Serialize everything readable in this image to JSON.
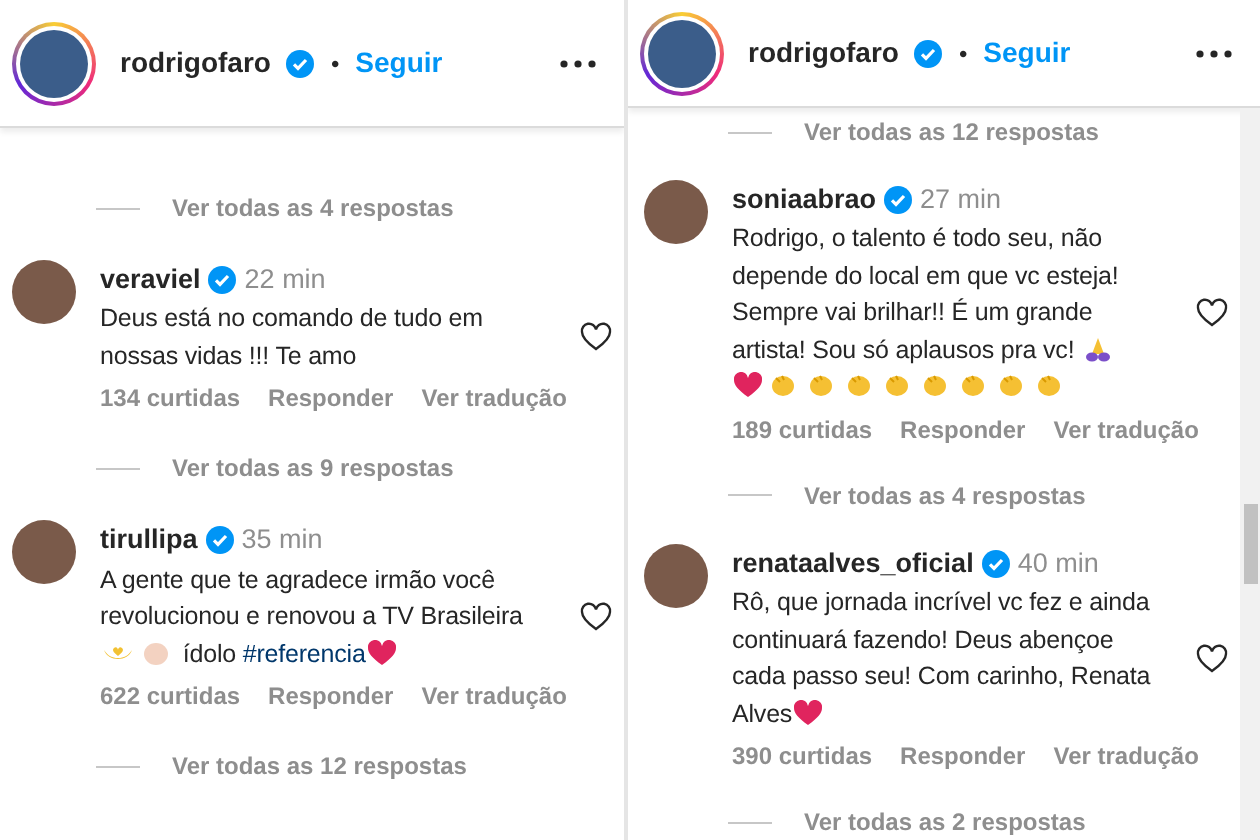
{
  "panels": [
    {
      "header": {
        "username": "rodrigofaro",
        "verified": true,
        "separator": "•",
        "follow": "Seguir"
      },
      "scrollbar": false,
      "items": [
        {
          "kind": "replies",
          "text": "Ver todas as 4 respostas"
        },
        {
          "kind": "comment",
          "username": "veraviel",
          "verified": true,
          "time": "22 min",
          "body": [
            {
              "kind": "text",
              "text": "Deus está no comando de tudo em nossas vidas !!! Te amo"
            }
          ],
          "likes": "134 curtidas",
          "reply": "Responder",
          "translate": "Ver tradução"
        },
        {
          "kind": "replies",
          "text": "Ver todas as 9 respostas"
        },
        {
          "kind": "comment",
          "username": "tirullipa",
          "verified": true,
          "time": "35 min",
          "body": [
            {
              "kind": "text",
              "text": "A gente que te agradece irmão você revolucionou e renovou a TV Brasileira "
            },
            {
              "kind": "hands-heart"
            },
            {
              "kind": "raised-hand"
            },
            {
              "kind": "text",
              "text": " ídolo "
            },
            {
              "kind": "hashtag",
              "text": "#referencia"
            },
            {
              "kind": "heart"
            }
          ],
          "likes": "622 curtidas",
          "reply": "Responder",
          "translate": "Ver tradução"
        },
        {
          "kind": "replies",
          "text": "Ver todas as 12 respostas"
        }
      ]
    },
    {
      "header": {
        "username": "rodrigofaro",
        "verified": true,
        "separator": "•",
        "follow": "Seguir"
      },
      "scrollbar": true,
      "items": [
        {
          "kind": "replies",
          "text": "Ver todas as 12 respostas"
        },
        {
          "kind": "comment",
          "username": "soniaabrao",
          "verified": true,
          "time": "27 min",
          "body": [
            {
              "kind": "text",
              "text": "Rodrigo, o talento é todo seu, não depende do local em que vc esteja! Sempre vai brilhar!! É um grande artista! Sou só aplausos pra vc! "
            },
            {
              "kind": "pray"
            },
            {
              "kind": "break"
            },
            {
              "kind": "heart"
            },
            {
              "kind": "clap"
            },
            {
              "kind": "clap"
            },
            {
              "kind": "clap"
            },
            {
              "kind": "clap"
            },
            {
              "kind": "clap"
            },
            {
              "kind": "clap"
            },
            {
              "kind": "clap"
            },
            {
              "kind": "clap"
            }
          ],
          "likes": "189 curtidas",
          "reply": "Responder",
          "translate": "Ver tradução"
        },
        {
          "kind": "replies",
          "text": "Ver todas as 4 respostas"
        },
        {
          "kind": "comment",
          "username": "renataalves_oficial",
          "verified": true,
          "time": "40 min",
          "body": [
            {
              "kind": "text",
              "text": "Rô, que jornada incrível vc fez e ainda continuará fazendo! Deus abençoe cada passo seu! Com carinho, Renata Alves"
            },
            {
              "kind": "heart"
            }
          ],
          "likes": "390 curtidas",
          "reply": "Responder",
          "translate": "Ver tradução"
        },
        {
          "kind": "replies",
          "text": "Ver todas as 2 respostas"
        }
      ]
    }
  ]
}
